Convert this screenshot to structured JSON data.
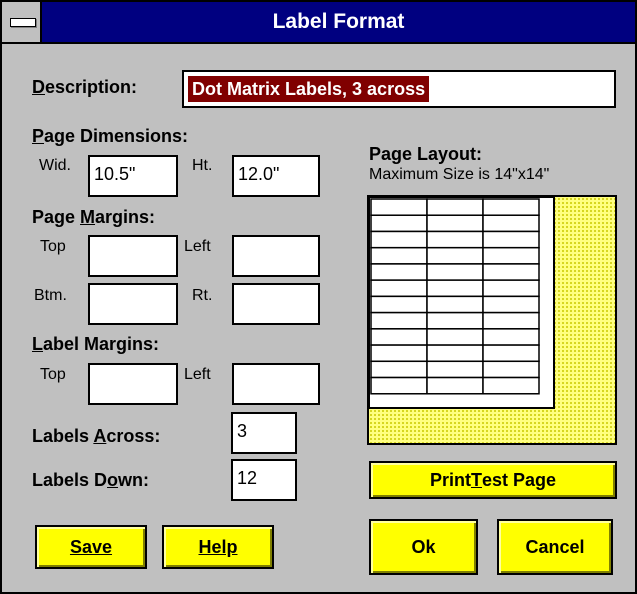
{
  "window": {
    "title": "Label Format",
    "system_menu_icon": "system-menu-icon"
  },
  "description": {
    "label": "Description:",
    "value": "Dot Matrix Labels, 3 across"
  },
  "page_dimensions": {
    "heading": "Page Dimensions:",
    "width_label": "Wid.",
    "width_value": "10.5\"",
    "height_label": "Ht.",
    "height_value": "12.0\""
  },
  "page_margins": {
    "heading": "Page Margins:",
    "top_label": "Top",
    "top_value": "",
    "left_label": "Left",
    "left_value": "",
    "bottom_label": "Btm.",
    "bottom_value": "",
    "right_label": "Rt.",
    "right_value": ""
  },
  "label_margins": {
    "heading": "Label Margins:",
    "top_label": "Top",
    "top_value": "",
    "left_label": "Left",
    "left_value": ""
  },
  "labels_across": {
    "label": "Labels Across:",
    "value": "3"
  },
  "labels_down": {
    "label": "Labels Down:",
    "value": "12"
  },
  "page_layout": {
    "heading": "Page Layout:",
    "subheading": "Maximum Size is 14\"x14\"",
    "columns": 3,
    "rows": 12,
    "page_fraction_width": 0.75,
    "page_fraction_height": 0.857
  },
  "buttons": {
    "save": "Save",
    "help": "Help",
    "print_test": "Print Test Page",
    "ok": "Ok",
    "cancel": "Cancel"
  },
  "colors": {
    "titlebar": "#000080",
    "dialog": "#c0c0c0",
    "button": "#ffff00",
    "selection": "#800000",
    "layout_bg": "#ffff80"
  }
}
